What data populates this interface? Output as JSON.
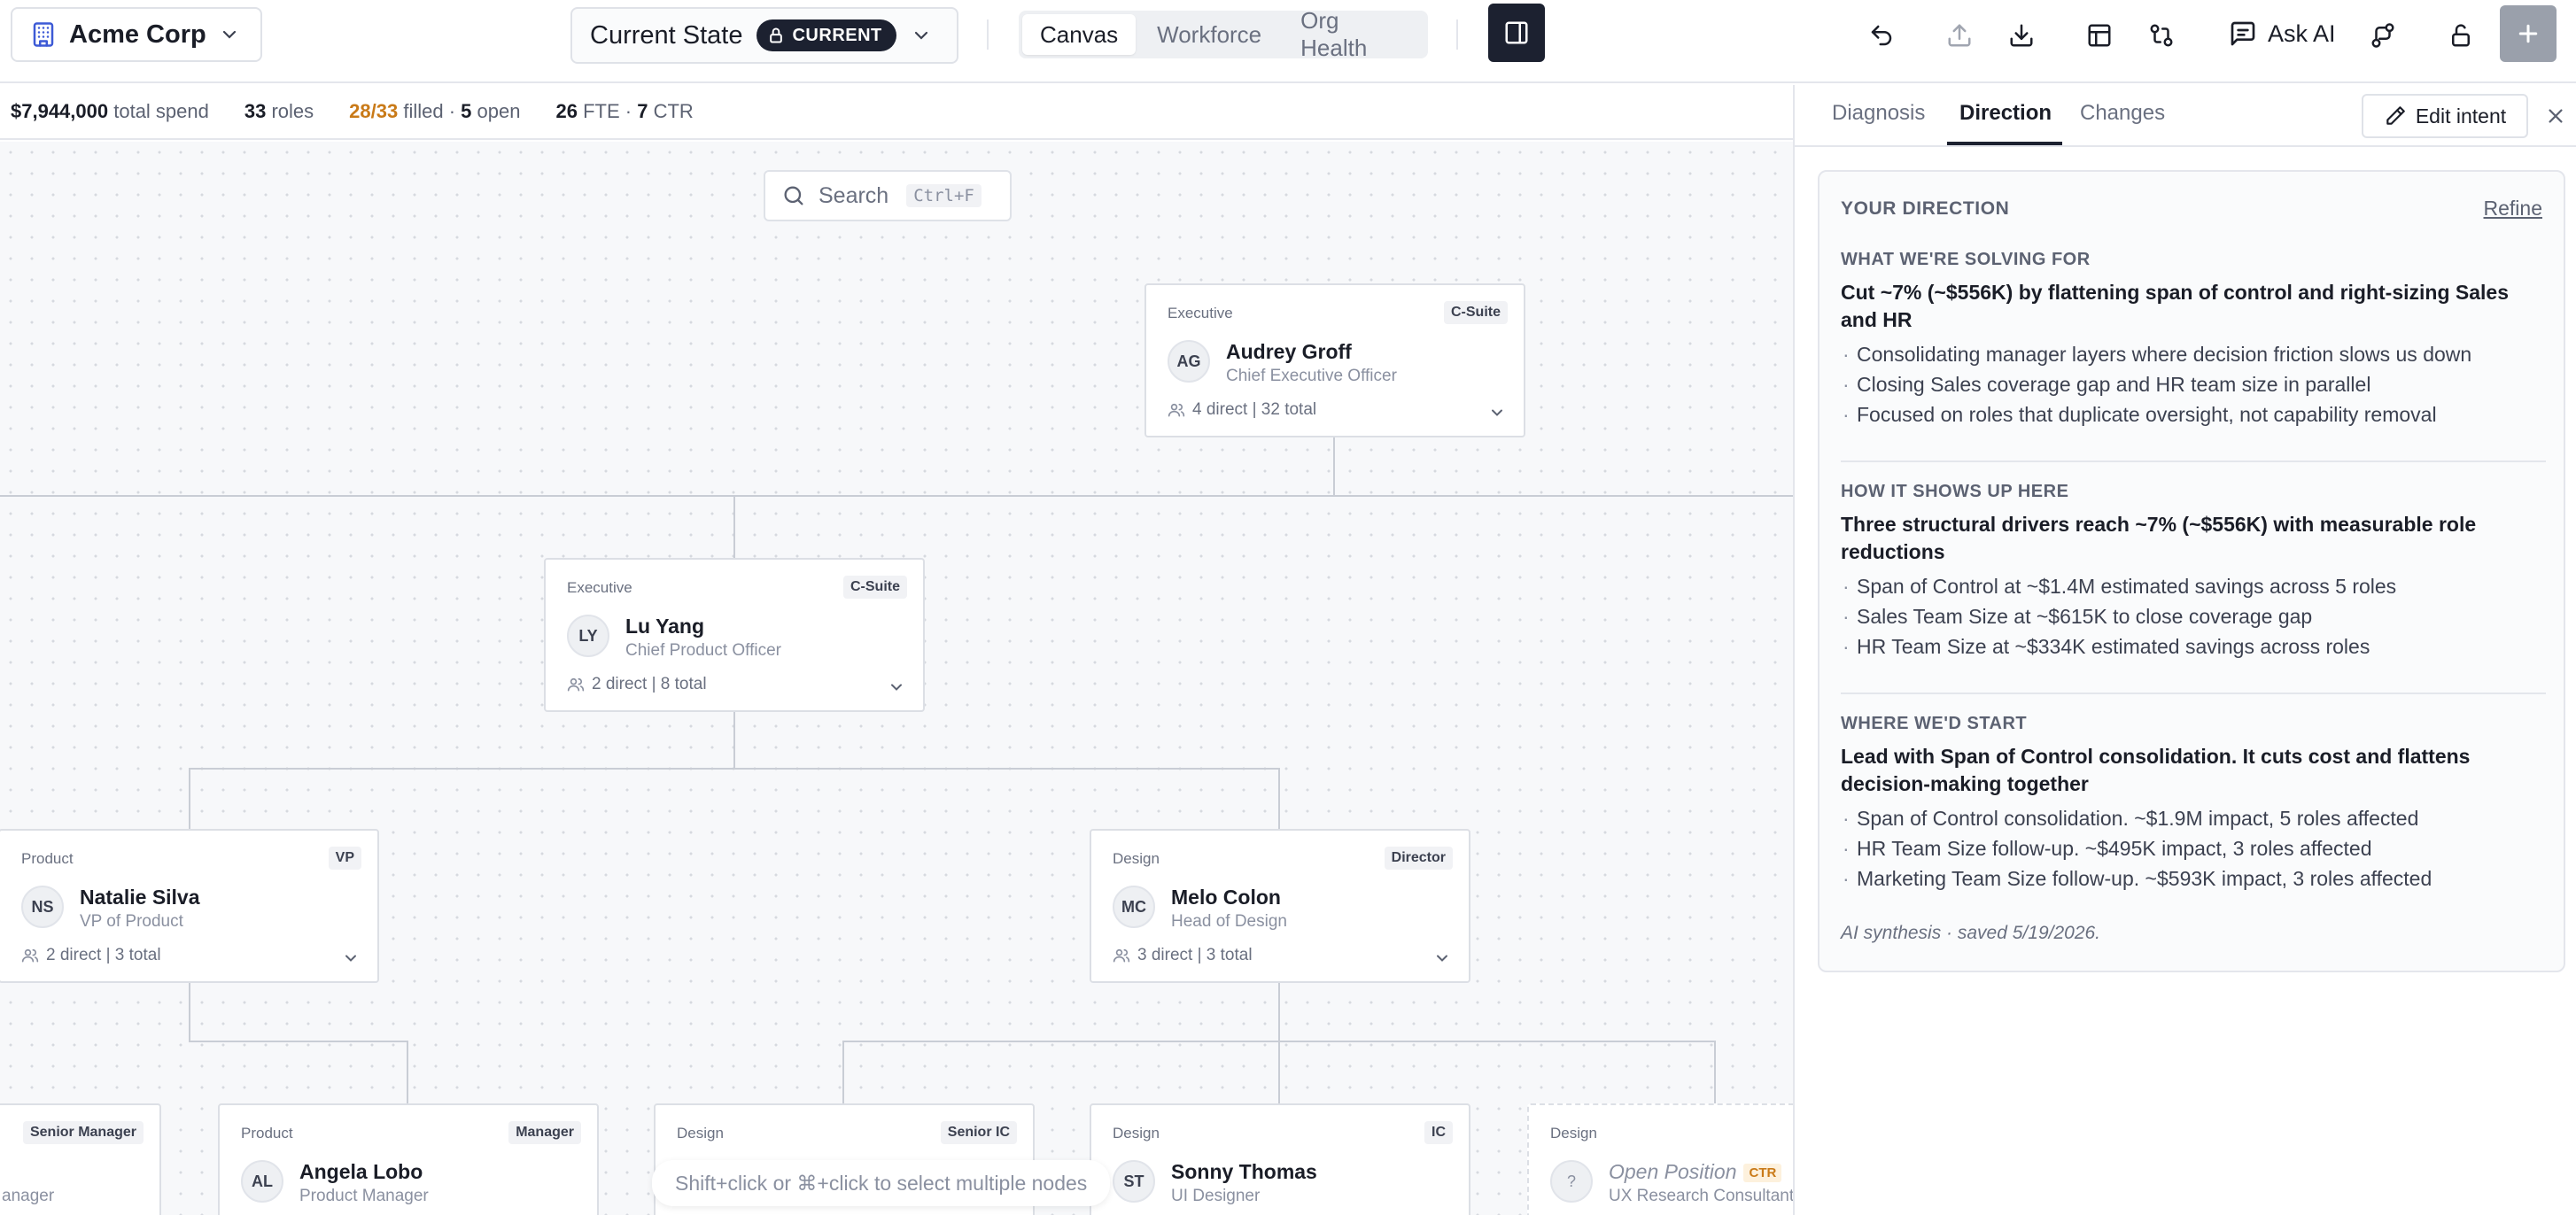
{
  "header": {
    "company": "Acme Corp",
    "state_label": "Current State",
    "state_badge": "CURRENT",
    "view_tabs": [
      "Canvas",
      "Workforce",
      "Org Health"
    ],
    "active_view": "Canvas",
    "ask_ai": "Ask AI"
  },
  "stats": {
    "spend_value": "$7,944,000",
    "spend_label": "total spend",
    "roles_value": "33",
    "roles_label": "roles",
    "filled_value": "28/33",
    "filled_label": "filled ·",
    "open_value": "5",
    "open_label": "open",
    "fte_value": "26",
    "fte_label": "FTE ·",
    "ctr_value": "7",
    "ctr_label": "CTR"
  },
  "canvas": {
    "search_placeholder": "Search",
    "search_shortcut": "Ctrl+F",
    "hint": "Shift+click or ⌘+click to select multiple nodes",
    "nodes": [
      {
        "dept": "Executive",
        "level": "C-Suite",
        "initials": "AG",
        "name": "Audrey Groff",
        "title": "Chief Executive Officer",
        "reports": "4 direct | 32 total"
      },
      {
        "dept": "Executive",
        "level": "C-Suite",
        "initials": "LY",
        "name": "Lu Yang",
        "title": "Chief Product Officer",
        "reports": "2 direct | 8 total"
      },
      {
        "dept": "Product",
        "level": "VP",
        "initials": "NS",
        "name": "Natalie Silva",
        "title": "VP of Product",
        "reports": "2 direct | 3 total"
      },
      {
        "dept": "Design",
        "level": "Director",
        "initials": "MC",
        "name": "Melo Colon",
        "title": "Head of Design",
        "reports": "3 direct | 3 total"
      },
      {
        "dept": "",
        "level": "Senior Manager",
        "initials": "",
        "name": "",
        "title": "anager",
        "reports": ""
      },
      {
        "dept": "Product",
        "level": "Manager",
        "initials": "AL",
        "name": "Angela Lobo",
        "title": "Product Manager",
        "reports": ""
      },
      {
        "dept": "Design",
        "level": "Senior IC",
        "initials": "",
        "name": "",
        "title": "",
        "reports": ""
      },
      {
        "dept": "Design",
        "level": "IC",
        "initials": "ST",
        "name": "Sonny Thomas",
        "title": "UI Designer",
        "reports": ""
      },
      {
        "dept": "Design",
        "level": "IC",
        "initials": "?",
        "name": "Open Position",
        "badge": "CTR",
        "title": "UX Research Consultant",
        "reports": ""
      }
    ]
  },
  "panel": {
    "tabs": [
      "Diagnosis",
      "Direction",
      "Changes"
    ],
    "active_tab": "Direction",
    "edit_intent": "Edit intent",
    "card_title": "YOUR DIRECTION",
    "refine": "Refine",
    "sections": [
      {
        "heading": "WHAT WE'RE SOLVING FOR",
        "title": "Cut ~7% (~$556K) by flattening span of control and right-sizing Sales and HR",
        "bullets": [
          "Consolidating manager layers where decision friction slows us down",
          "Closing Sales coverage gap and HR team size in parallel",
          "Focused on roles that duplicate oversight, not capability removal"
        ]
      },
      {
        "heading": "HOW IT SHOWS UP HERE",
        "title": "Three structural drivers reach ~7% (~$556K) with measurable role reductions",
        "bullets": [
          "Span of Control at ~$1.4M estimated savings across 5 roles",
          "Sales Team Size at ~$615K to close coverage gap",
          "HR Team Size at ~$334K estimated savings across roles"
        ]
      },
      {
        "heading": "WHERE WE'D START",
        "title": "Lead with Span of Control consolidation. It cuts cost and flattens decision-making together",
        "bullets": [
          "Span of Control consolidation. ~$1.9M impact, 5 roles affected",
          "HR Team Size follow-up. ~$495K impact, 3 roles affected",
          "Marketing Team Size follow-up. ~$593K impact, 3 roles affected"
        ]
      }
    ],
    "footer": "AI synthesis · saved 5/19/2026."
  }
}
